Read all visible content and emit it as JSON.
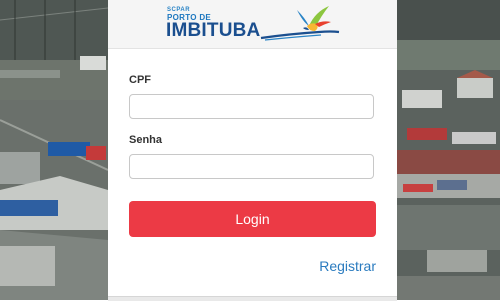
{
  "logo": {
    "line1": "SCPAR",
    "line2": "PORTO DE",
    "line3": "IMBITUBA"
  },
  "form": {
    "cpf_label": "CPF",
    "cpf_value": "",
    "senha_label": "Senha",
    "senha_value": "",
    "login_label": "Login",
    "register_label": "Registrar"
  },
  "colors": {
    "login_button": "#ec3a45",
    "link": "#2a7bbf",
    "brand_dark_blue": "#1b4f8f",
    "brand_light_blue": "#2a84c6"
  }
}
